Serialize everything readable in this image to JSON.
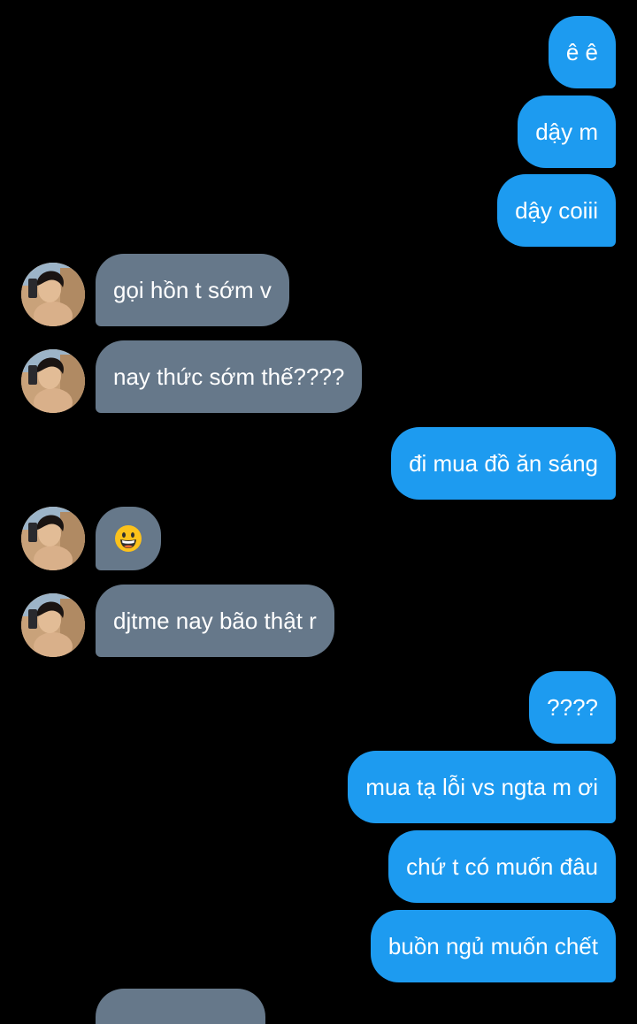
{
  "messages": [
    {
      "side": "sent",
      "text": "ê ê"
    },
    {
      "side": "sent",
      "text": "dậy m"
    },
    {
      "side": "sent",
      "text": "dậy coiii"
    },
    {
      "side": "received",
      "text": "gọi hồn t sớm v"
    },
    {
      "side": "received",
      "text": "nay thức sớm thế????"
    },
    {
      "side": "sent",
      "text": "đi mua đồ ăn sáng"
    },
    {
      "side": "received",
      "text": "",
      "emoji": "grinning-face-emoji"
    },
    {
      "side": "received",
      "text": "djtme nay bão thật r"
    },
    {
      "side": "sent",
      "text": "????"
    },
    {
      "side": "sent",
      "text": "mua tạ lỗi vs ngta m ơi"
    },
    {
      "side": "sent",
      "text": "chứ t có muốn đâu"
    },
    {
      "side": "sent",
      "text": "buồn ngủ muốn chết"
    }
  ],
  "colors": {
    "background": "#000000",
    "sent_bubble": "#1d9bf0",
    "received_bubble": "#66788a",
    "text": "#ffffff"
  },
  "icons": {
    "contact_avatar": "contact-avatar-photo",
    "emoji": "grinning-face-emoji"
  }
}
